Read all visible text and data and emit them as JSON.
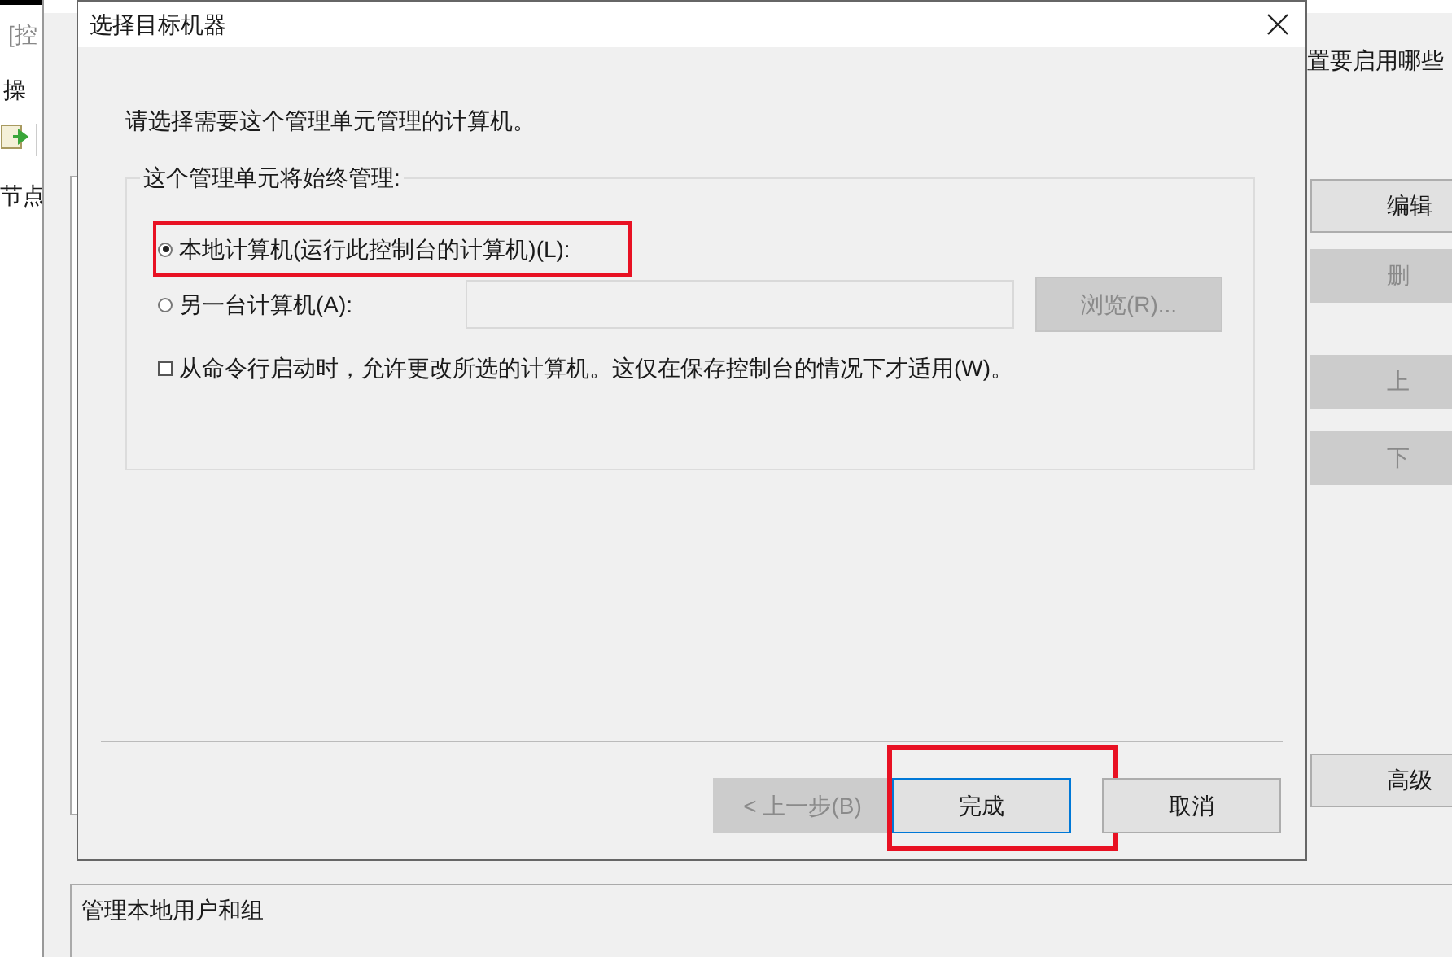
{
  "background_window": {
    "title_fragment": "[控",
    "menu_item": "操",
    "tree_header": "节点",
    "instruction_fragment": "置要启用哪些",
    "buttons": [
      {
        "label": "编辑",
        "disabled": false
      },
      {
        "label": "删",
        "disabled": true
      },
      {
        "label": "上",
        "disabled": true
      },
      {
        "label": "下",
        "disabled": true
      },
      {
        "label": "高级",
        "disabled": false
      }
    ],
    "description": "管理本地用户和组"
  },
  "dialog": {
    "title": "选择目标机器",
    "prompt": "请选择需要这个管理单元管理的计算机。",
    "group_label": "这个管理单元将始终管理:",
    "options": [
      {
        "label": "本地计算机(运行此控制台的计算机)(L):",
        "selected": true,
        "highlighted": true
      },
      {
        "label": "另一台计算机(A):",
        "selected": false,
        "highlighted": false
      }
    ],
    "computer_field": {
      "disabled": true
    },
    "browse_button": {
      "label": "浏览(R)...",
      "disabled": true
    },
    "allow_change": {
      "label": "从命令行启动时，允许更改所选的计算机。这仅在保存控制台的情况下才适用(W)。",
      "checked": false
    },
    "buttons": [
      {
        "label": "< 上一步(B)",
        "disabled": true,
        "default": false,
        "highlighted": false
      },
      {
        "label": "完成",
        "disabled": false,
        "default": true,
        "highlighted": true
      },
      {
        "label": "取消",
        "disabled": false,
        "default": false,
        "highlighted": false
      }
    ]
  }
}
